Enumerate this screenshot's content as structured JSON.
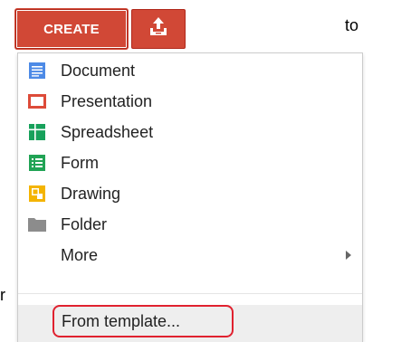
{
  "toolbar": {
    "create_label": "CREATE",
    "upload_icon": "upload-icon",
    "brand_color": "#d14836"
  },
  "background_text": {
    "top_right": "to",
    "bottom_left": "r"
  },
  "menu": {
    "items": [
      {
        "label": "Document",
        "icon": "document-icon",
        "color": "#4d8ae6"
      },
      {
        "label": "Presentation",
        "icon": "presentation-icon",
        "color": "#dd4b39"
      },
      {
        "label": "Spreadsheet",
        "icon": "spreadsheet-icon",
        "color": "#17a15b"
      },
      {
        "label": "Form",
        "icon": "form-icon",
        "color": "#21a355"
      },
      {
        "label": "Drawing",
        "icon": "drawing-icon",
        "color": "#f4b400"
      },
      {
        "label": "Folder",
        "icon": "folder-icon",
        "color": "#8c8c8c"
      },
      {
        "label": "More",
        "icon": "chevron-right-icon",
        "color": "#666666"
      }
    ],
    "from_template": "From template...",
    "highlight_color": "#e0212f"
  }
}
